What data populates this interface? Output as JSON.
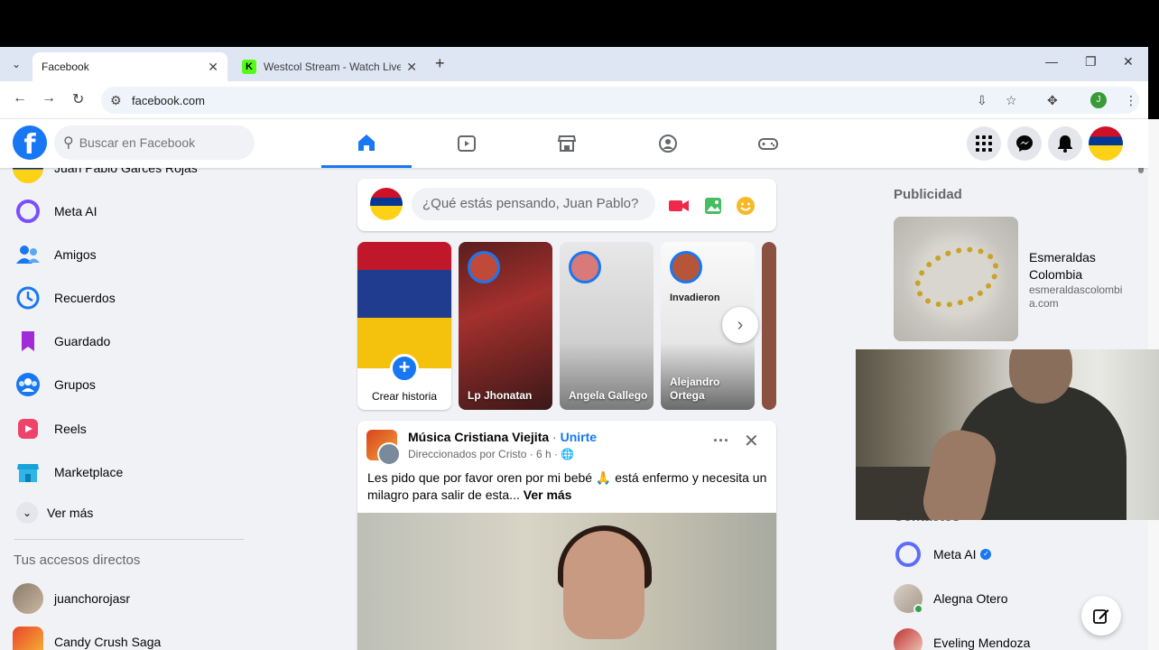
{
  "browser": {
    "tabs": [
      {
        "title": "Facebook",
        "active": true
      },
      {
        "title": "Westcol Stream - Watch Live on",
        "active": false
      }
    ],
    "url": "facebook.com",
    "profile_initial": "J"
  },
  "topbar": {
    "search_placeholder": "Buscar en Facebook",
    "nav_tabs": [
      "home-icon",
      "video-icon",
      "marketplace-icon",
      "groups-icon",
      "gaming-icon"
    ],
    "active_tab": "home-icon"
  },
  "left_sidebar": {
    "profile_name": "Juan Pablo Garces Rojas",
    "items": [
      {
        "label": "Meta AI",
        "icon": "meta-ai-icon"
      },
      {
        "label": "Amigos",
        "icon": "friends-icon"
      },
      {
        "label": "Recuerdos",
        "icon": "memories-icon"
      },
      {
        "label": "Guardado",
        "icon": "saved-icon"
      },
      {
        "label": "Grupos",
        "icon": "groups-icon"
      },
      {
        "label": "Reels",
        "icon": "reels-icon"
      },
      {
        "label": "Marketplace",
        "icon": "marketplace-icon"
      }
    ],
    "see_more": "Ver más",
    "shortcuts_heading": "Tus accesos directos",
    "shortcuts": [
      {
        "label": "juanchorojasr"
      },
      {
        "label": "Candy Crush Saga"
      }
    ]
  },
  "composer": {
    "placeholder": "¿Qué estás pensando, Juan Pablo?"
  },
  "stories": {
    "create_label": "Crear historia",
    "items": [
      {
        "name": "Lp Jhonatan"
      },
      {
        "name": "Angela Gallego"
      },
      {
        "name": "Alejandro Ortega"
      }
    ],
    "card3_heading": "Invadieron"
  },
  "post": {
    "author": "Música Cristiana Viejita",
    "separator": " · ",
    "join_label": "Unirte",
    "meta": "Direccionados por Cristo · 6 h · ",
    "body": "Les pido que por favor oren por mi bebé 🙏 está enfermo y necesita un milagro para salir de esta...",
    "see_more": "Ver más"
  },
  "right_sidebar": {
    "ads_heading": "Publicidad",
    "ad": {
      "name": "Esmeraldas Colombia",
      "url": "esmeraldascolombia.com"
    },
    "contacts_heading": "Contactos",
    "contacts": [
      {
        "name": "Meta AI",
        "verified": true
      },
      {
        "name": "Alegna Otero",
        "online": true
      },
      {
        "name": "Eveling Mendoza",
        "online": false
      }
    ]
  },
  "colors": {
    "brand_blue": "#1877f2",
    "page_bg": "#f0f2f5",
    "online_green": "#31a24c"
  }
}
